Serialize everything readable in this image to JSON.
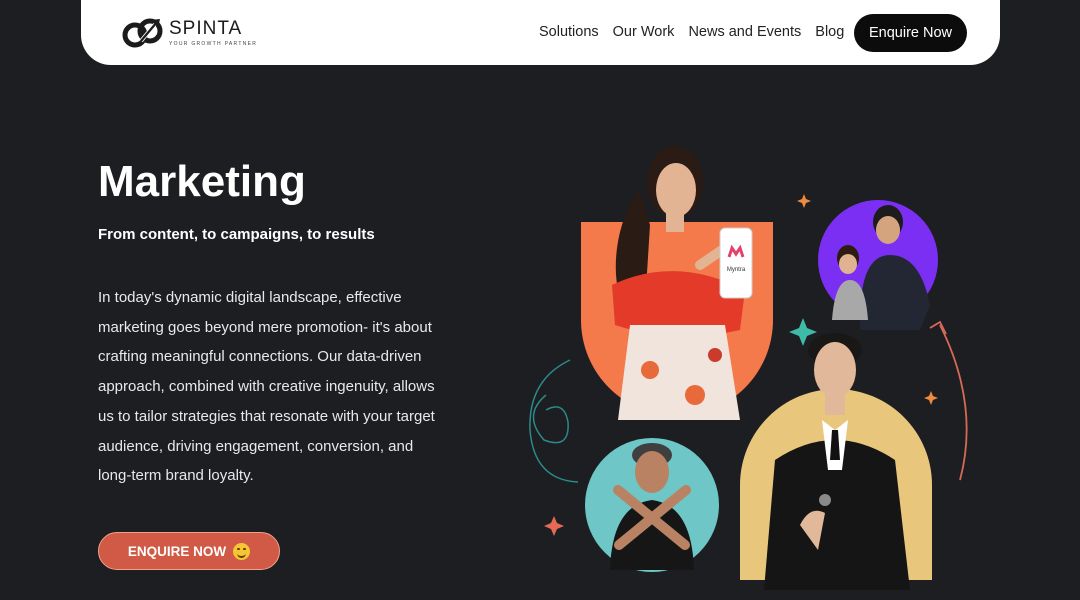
{
  "brand": {
    "name": "SPINTA",
    "tagline": "YOUR GROWTH PARTNER"
  },
  "nav": {
    "links": [
      "Solutions",
      "Our Work",
      "News and Events",
      "Blog"
    ],
    "cta_label": "Enquire Now"
  },
  "hero": {
    "title": "Marketing",
    "subtitle": "From content, to campaigns, to results",
    "description": "In today's dynamic digital landscape, effective marketing goes beyond mere promotion- it's about crafting meaningful connections. Our data-driven approach, combined with creative ingenuity, allows us to tailor strategies that resonate with your target audience, driving engagement, conversion, and long-term brand loyalty.",
    "cta_label": "ENQUIRE NOW"
  },
  "collage": {
    "phone_brand": "Myntra"
  },
  "colors": {
    "background": "#1d1e22",
    "accent_orange": "#f47a4c",
    "accent_purple": "#7b2ff2",
    "accent_cyan": "#6ec6c6",
    "accent_yellow": "#e8c77d",
    "cta_red": "#d05a45"
  },
  "icons": [
    "spinta-logo-icon",
    "smiley-emoji-icon",
    "sparkle-icon",
    "arrow-icon"
  ]
}
